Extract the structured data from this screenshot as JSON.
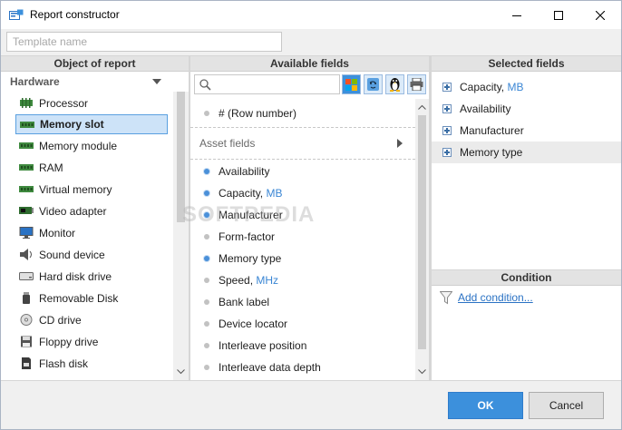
{
  "window": {
    "title": "Report constructor"
  },
  "template": {
    "placeholder": "Template name",
    "value": ""
  },
  "panes": {
    "object": {
      "header": "Object of report"
    },
    "available": {
      "header": "Available fields"
    },
    "selected": {
      "header": "Selected fields"
    },
    "condition": {
      "header": "Condition"
    }
  },
  "objects": {
    "group": "Hardware",
    "items": [
      {
        "label": "Processor",
        "icon": "chip-icon"
      },
      {
        "label": "Memory slot",
        "icon": "memory-icon",
        "selected": true
      },
      {
        "label": "Memory module",
        "icon": "memory-icon"
      },
      {
        "label": "RAM",
        "icon": "memory-icon"
      },
      {
        "label": "Virtual memory",
        "icon": "memory-icon"
      },
      {
        "label": "Video adapter",
        "icon": "video-card-icon"
      },
      {
        "label": "Monitor",
        "icon": "monitor-icon"
      },
      {
        "label": "Sound device",
        "icon": "speaker-icon"
      },
      {
        "label": "Hard disk drive",
        "icon": "hdd-icon"
      },
      {
        "label": "Removable Disk",
        "icon": "usb-drive-icon"
      },
      {
        "label": "CD drive",
        "icon": "cd-icon"
      },
      {
        "label": "Floppy drive",
        "icon": "floppy-icon"
      },
      {
        "label": "Flash disk",
        "icon": "sd-card-icon"
      }
    ]
  },
  "available": {
    "search_placeholder": "",
    "os_filters": [
      "windows-icon",
      "mac-icon",
      "linux-icon",
      "printer-icon"
    ],
    "row_number": "# (Row number)",
    "section": "Asset fields",
    "fields": [
      {
        "label": "Availability",
        "unit": "",
        "used": true
      },
      {
        "label": "Capacity,",
        "unit": "MB",
        "used": true
      },
      {
        "label": "Manufacturer",
        "unit": "",
        "used": true
      },
      {
        "label": "Form-factor",
        "unit": "",
        "used": false
      },
      {
        "label": "Memory type",
        "unit": "",
        "used": true
      },
      {
        "label": "Speed,",
        "unit": "MHz",
        "used": false
      },
      {
        "label": "Bank label",
        "unit": "",
        "used": false
      },
      {
        "label": "Device locator",
        "unit": "",
        "used": false
      },
      {
        "label": "Interleave position",
        "unit": "",
        "used": false
      },
      {
        "label": "Interleave data depth",
        "unit": "",
        "used": false
      }
    ]
  },
  "selected": {
    "items": [
      {
        "label": "Capacity,",
        "unit": "MB"
      },
      {
        "label": "Availability",
        "unit": ""
      },
      {
        "label": "Manufacturer",
        "unit": ""
      },
      {
        "label": "Memory type",
        "unit": ""
      }
    ]
  },
  "condition": {
    "add_label": "Add condition..."
  },
  "buttons": {
    "ok": "OK",
    "cancel": "Cancel"
  },
  "watermark": "SOFTPEDIA",
  "colors": {
    "accent": "#3c90dc",
    "selection": "#cde3f8",
    "link": "#2a72c4",
    "unit": "#3a86d4"
  }
}
